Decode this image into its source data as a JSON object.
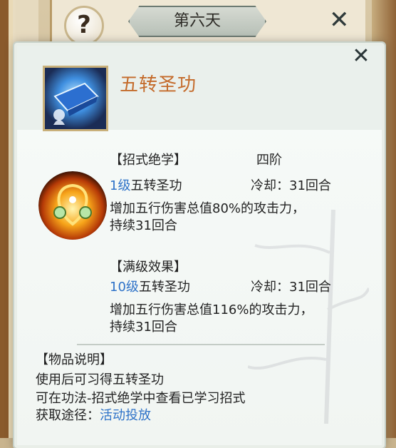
{
  "background": {
    "help_symbol": "?",
    "day_title": "第六天",
    "close_symbol": "✕"
  },
  "tooltip": {
    "close_symbol": "✕",
    "item_name": "五转圣功",
    "skill_section_label": "【招式绝学】",
    "skill_tier": "四阶",
    "current": {
      "level": "1级",
      "skill_name": "五转圣功",
      "cooldown": "冷却：31回合",
      "description_line1": "增加五行伤害总值80%的攻击力，",
      "description_line2": "持续31回合"
    },
    "max_section_label": "【满级效果】",
    "max": {
      "level": "10级",
      "skill_name": "五转圣功",
      "cooldown": "冷却：31回合",
      "description_line1": "增加五行伤害总值116%的攻击力，",
      "description_line2": "持续31回合"
    },
    "item_desc_label": "【物品说明】",
    "item_desc_line1": "使用后可习得五转圣功",
    "item_desc_line2": "可在功法-招式绝学中查看已学习招式",
    "source_label": "获取途径：",
    "source_value": "活动投放"
  },
  "colors": {
    "item_name": "#c46a2a",
    "highlight_blue": "#2e72c8",
    "text": "#222222"
  }
}
